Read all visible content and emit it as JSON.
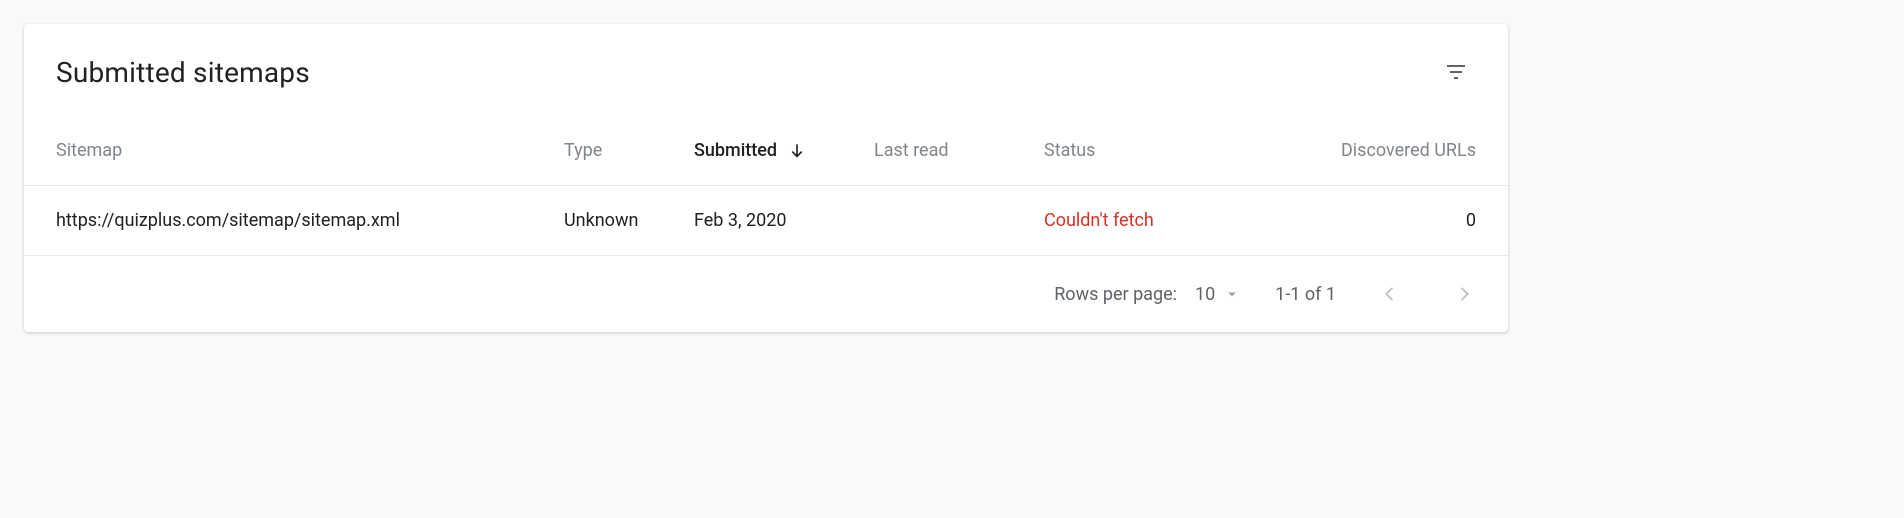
{
  "header": {
    "title": "Submitted sitemaps"
  },
  "table": {
    "columns": {
      "sitemap": "Sitemap",
      "type": "Type",
      "submitted": "Submitted",
      "last_read": "Last read",
      "status": "Status",
      "discovered": "Discovered URLs"
    },
    "rows": [
      {
        "sitemap": "https://quizplus.com/sitemap/sitemap.xml",
        "type": "Unknown",
        "submitted": "Feb 3, 2020",
        "last_read": "",
        "status": "Couldn't fetch",
        "discovered": "0"
      }
    ]
  },
  "pager": {
    "rows_per_page_label": "Rows per page:",
    "rows_per_page_value": "10",
    "range": "1-1 of 1"
  }
}
